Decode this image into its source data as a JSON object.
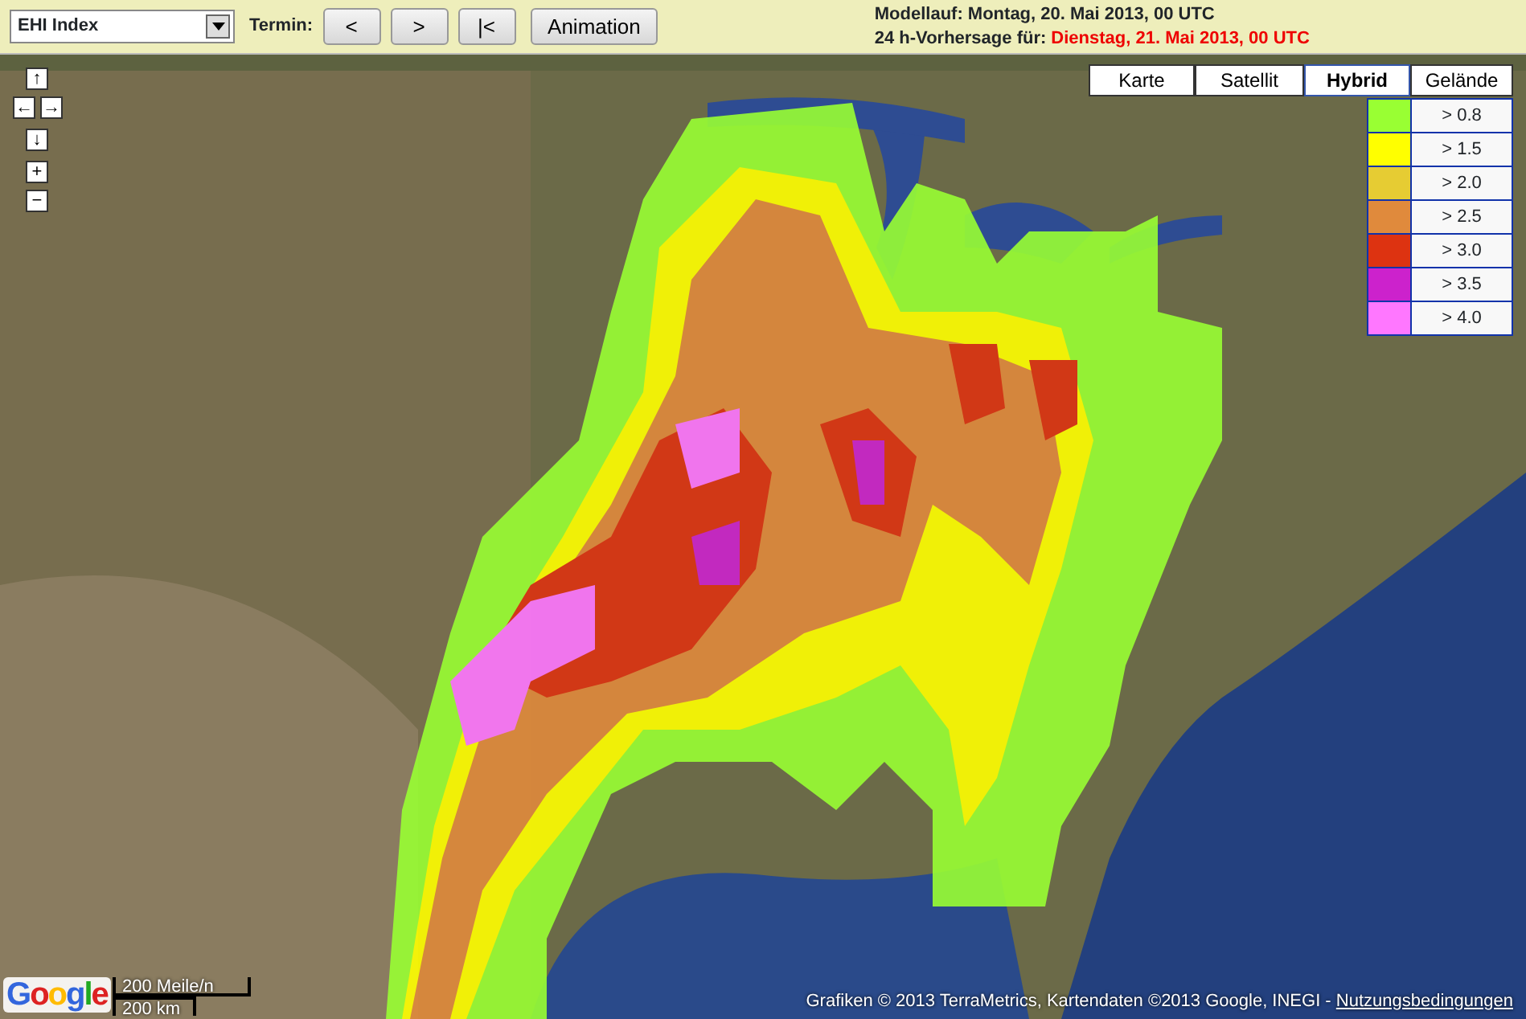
{
  "toolbar": {
    "product_select": {
      "value": "EHI Index"
    },
    "termin_label": "Termin:",
    "buttons": [
      "<",
      ">",
      "|<",
      "Animation"
    ],
    "model_run": "Modellauf: Montag, 20. Mai 2013, 00 UTC",
    "forecast_label": "24 h-Vorhersage für:",
    "forecast_date": "Dienstag, 21. Mai 2013, 00 UTC"
  },
  "map": {
    "nav_controls": [
      {
        "kind": "pan-up",
        "label": "↑"
      },
      {
        "kind": "pan-left",
        "label": "←"
      },
      {
        "kind": "pan-right",
        "label": "→"
      },
      {
        "kind": "pan-down",
        "label": "↓"
      },
      {
        "kind": "zoom-in",
        "label": "+"
      },
      {
        "kind": "zoom-out",
        "label": "−"
      }
    ],
    "map_types": [
      {
        "label": "Karte",
        "selected": false
      },
      {
        "label": "Satellit",
        "selected": false
      },
      {
        "label": "Hybrid",
        "selected": true
      },
      {
        "label": "Gelände",
        "selected": false
      }
    ],
    "legend": [
      {
        "label": "> 0.8",
        "color": "#99ff33"
      },
      {
        "label": "> 1.5",
        "color": "#ffff00"
      },
      {
        "label": "> 2.0",
        "color": "#e6cc33"
      },
      {
        "label": "> 2.5",
        "color": "#e08a3c"
      },
      {
        "label": "> 3.0",
        "color": "#dd3311"
      },
      {
        "label": "> 3.5",
        "color": "#cc22cc"
      },
      {
        "label": "> 4.0",
        "color": "#ff77ff"
      }
    ],
    "scale": {
      "miles": "200 Meile/n",
      "km": "200 km"
    },
    "logo": "Google",
    "attribution": "Grafiken © 2013 TerraMetrics, Kartendaten ©2013 Google, INEGI - ",
    "terms_link": "Nutzungsbedingungen"
  }
}
